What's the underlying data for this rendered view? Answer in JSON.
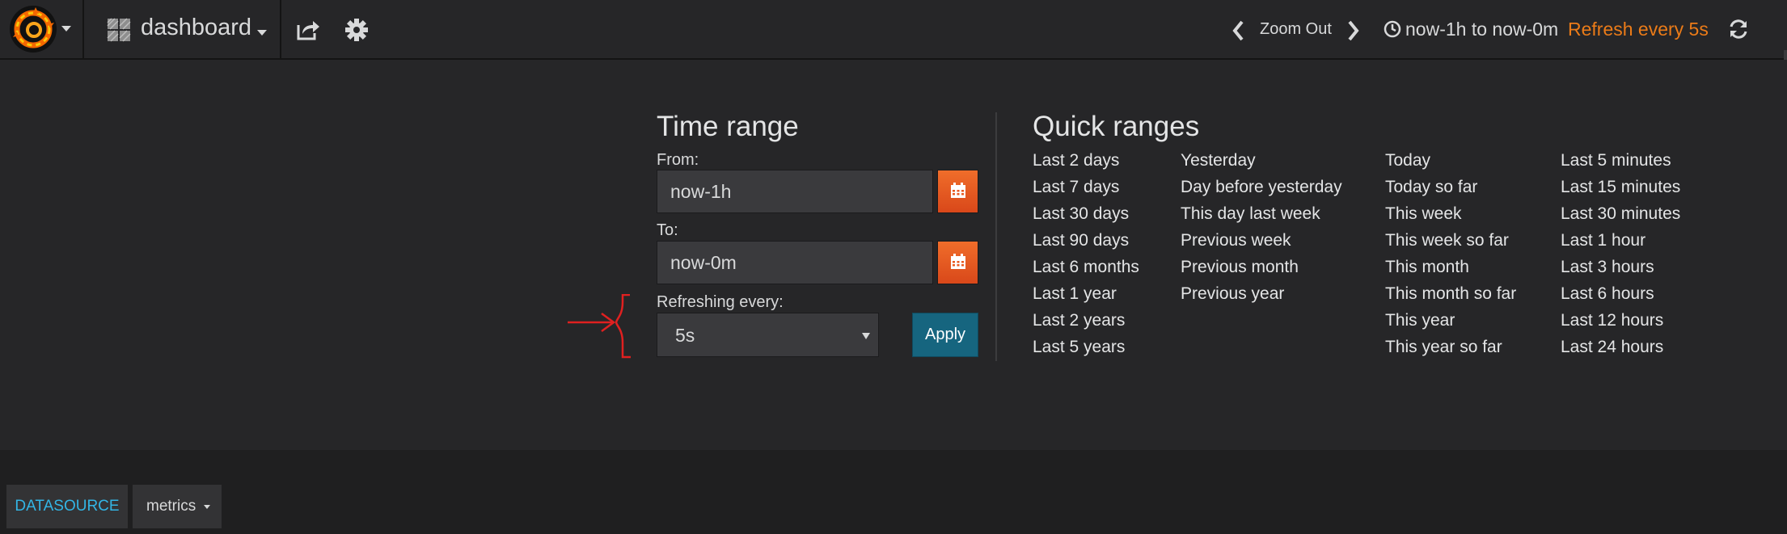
{
  "navbar": {
    "dashboard_title": "dashboard",
    "zoom_out_label": "Zoom Out",
    "time_range_label": "now-1h to now-0m",
    "refresh_label": "Refresh every 5s"
  },
  "time_range": {
    "title": "Time range",
    "from_label": "From:",
    "from_value": "now-1h",
    "to_label": "To:",
    "to_value": "now-0m",
    "refreshing_label": "Refreshing every:",
    "refresh_value": "5s",
    "apply_label": "Apply"
  },
  "quick_ranges": {
    "title": "Quick ranges",
    "columns": [
      [
        "Last 2 days",
        "Last 7 days",
        "Last 30 days",
        "Last 90 days",
        "Last 6 months",
        "Last 1 year",
        "Last 2 years",
        "Last 5 years"
      ],
      [
        "Yesterday",
        "Day before yesterday",
        "This day last week",
        "Previous week",
        "Previous month",
        "Previous year"
      ],
      [
        "Today",
        "Today so far",
        "This week",
        "This week so far",
        "This month",
        "This month so far",
        "This year",
        "This year so far"
      ],
      [
        "Last 5 minutes",
        "Last 15 minutes",
        "Last 30 minutes",
        "Last 1 hour",
        "Last 3 hours",
        "Last 6 hours",
        "Last 12 hours",
        "Last 24 hours"
      ]
    ]
  },
  "templating": {
    "datasource_label": "DATASOURCE",
    "metrics_label": "metrics"
  },
  "colors": {
    "accent_orange": "#eb7b18",
    "apply_blue": "#16657f",
    "datasource_cyan": "#33b5e5",
    "annotation_red": "#e02020"
  }
}
